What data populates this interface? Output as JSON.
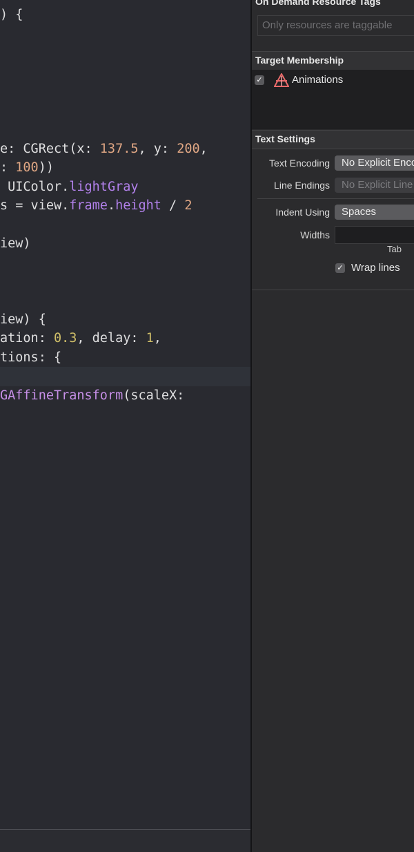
{
  "editor": {
    "lines": [
      [
        {
          "t": ") {",
          "c": ""
        }
      ],
      [
        {
          "t": "e: CGRect(x: ",
          "c": ""
        },
        {
          "t": "137.5",
          "c": "num2"
        },
        {
          "t": ", y: ",
          "c": ""
        },
        {
          "t": "200",
          "c": "num2"
        },
        {
          "t": ",",
          "c": ""
        }
      ],
      [
        {
          "t": ": ",
          "c": ""
        },
        {
          "t": "100",
          "c": "num2"
        },
        {
          "t": "))",
          "c": ""
        }
      ],
      [
        {
          "t": " UIColor.",
          "c": ""
        },
        {
          "t": "lightGray",
          "c": "prop"
        }
      ],
      [
        {
          "t": "s = view.",
          "c": ""
        },
        {
          "t": "frame",
          "c": "prop"
        },
        {
          "t": ".",
          "c": ""
        },
        {
          "t": "height",
          "c": "prop"
        },
        {
          "t": " / ",
          "c": ""
        },
        {
          "t": "2",
          "c": "num2"
        }
      ],
      [
        {
          "t": "iew)",
          "c": ""
        }
      ],
      [
        {
          "t": "iew) {",
          "c": ""
        }
      ],
      [
        {
          "t": "ation: ",
          "c": ""
        },
        {
          "t": "0.3",
          "c": "num"
        },
        {
          "t": ", delay: ",
          "c": ""
        },
        {
          "t": "1",
          "c": "num"
        },
        {
          "t": ",",
          "c": ""
        }
      ],
      [
        {
          "t": "tions: {",
          "c": ""
        }
      ],
      [
        {
          "t": "GAffineTransform",
          "c": "func"
        },
        {
          "t": "(scaleX:",
          "c": ""
        }
      ]
    ]
  },
  "inspector": {
    "on_demand": {
      "title": "On Demand Resource Tags",
      "placeholder": "Only resources are taggable"
    },
    "target_membership": {
      "title": "Target Membership",
      "target_name": "Animations",
      "checked_mark": "✓"
    },
    "text_settings": {
      "title": "Text Settings",
      "text_encoding_label": "Text Encoding",
      "text_encoding_value": "No Explicit Encoding",
      "line_endings_label": "Line Endings",
      "line_endings_value": "No Explicit Line Endings",
      "indent_using_label": "Indent Using",
      "indent_using_value": "Spaces",
      "widths_label": "Widths",
      "tab_label": "Tab",
      "wrap_lines_label": "Wrap lines",
      "wrap_checked_mark": "✓"
    }
  }
}
